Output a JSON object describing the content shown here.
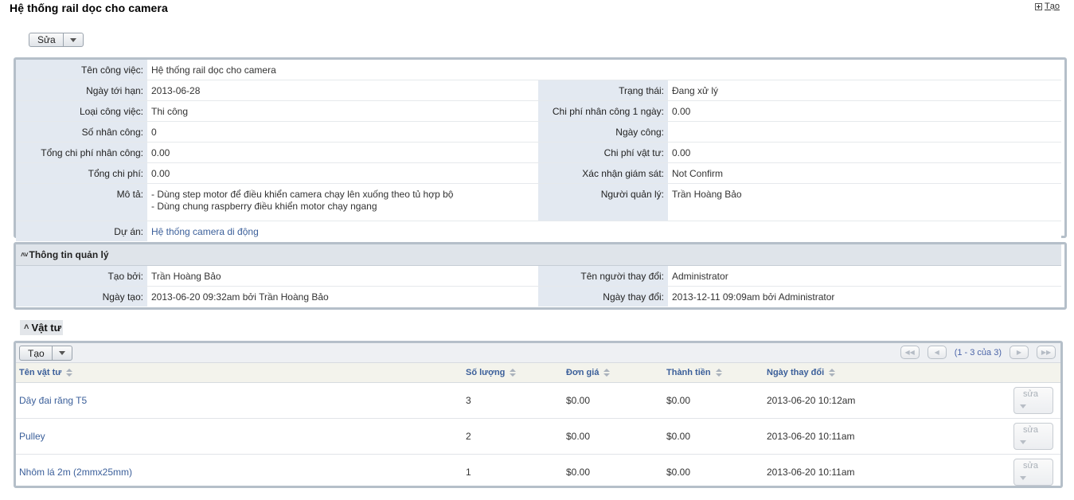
{
  "page": {
    "title": "Hệ thống rail dọc cho camera",
    "create_link": "Tạo"
  },
  "edit_button": {
    "label": "Sửa"
  },
  "details": {
    "task_name": {
      "label": "Tên công việc:",
      "value": "Hệ thống rail dọc cho camera"
    },
    "due_date": {
      "label": "Ngày tới hạn:",
      "value": "2013-06-28"
    },
    "status": {
      "label": "Trạng thái:",
      "value": "Đang xử lý"
    },
    "task_type": {
      "label": "Loại công việc:",
      "value": "Thi công"
    },
    "daily_labor_cost": {
      "label": "Chi phí nhân công 1 ngày:",
      "value": "0.00"
    },
    "workers": {
      "label": "Số nhân công:",
      "value": "0"
    },
    "work_days": {
      "label": "Ngày công:",
      "value": ""
    },
    "total_labor_cost": {
      "label": "Tổng chi phí nhân công:",
      "value": "0.00"
    },
    "material_cost": {
      "label": "Chi phí vật tư:",
      "value": "0.00"
    },
    "total_cost": {
      "label": "Tổng chi phí:",
      "value": "0.00"
    },
    "supervisor_confirm": {
      "label": "Xác nhận giám sát:",
      "value": "Not Confirm"
    },
    "description": {
      "label": "Mô tả:",
      "line1": "- Dùng step motor để điều khiển camera chạy lên xuống theo tủ hợp bộ",
      "line2": "- Dùng chung raspberry điều khiển motor chạy ngang"
    },
    "manager": {
      "label": "Người quản lý:",
      "value": "Trần Hoàng Bảo"
    },
    "project": {
      "label": "Dự án:",
      "value": "Hệ thống camera di động"
    }
  },
  "management": {
    "header": "Thông tin quản lý",
    "created_by": {
      "label": "Tạo bởi:",
      "value": "Trần Hoàng Bảo"
    },
    "modified_by": {
      "label": "Tên người thay đổi:",
      "value": "Administrator"
    },
    "created_date": {
      "label": "Ngày tạo:",
      "value": "2013-06-20 09:32am bởi Trần Hoàng Bảo"
    },
    "modified_date": {
      "label": "Ngày thay đổi:",
      "value": "2013-12-11 09:09am bởi Administrator"
    }
  },
  "materials": {
    "heading": "Vật tư",
    "create_label": "Tạo",
    "pager_text": "(1 - 3 của 3)",
    "columns": {
      "name": "Tên vật tư",
      "quantity": "Số lượng",
      "unit_price": "Đơn giá",
      "amount": "Thành tiền",
      "modified": "Ngày thay đổi"
    },
    "edit_label": "sửa",
    "rows": [
      {
        "name": "Dây đai răng T5",
        "quantity": "3",
        "unit_price": "$0.00",
        "amount": "$0.00",
        "modified": "2013-06-20 10:12am"
      },
      {
        "name": "Pulley",
        "quantity": "2",
        "unit_price": "$0.00",
        "amount": "$0.00",
        "modified": "2013-06-20 10:11am"
      },
      {
        "name": "Nhôm lá 2m (2mmx25mm)",
        "quantity": "1",
        "unit_price": "$0.00",
        "amount": "$0.00",
        "modified": "2013-06-20 10:11am"
      }
    ]
  }
}
